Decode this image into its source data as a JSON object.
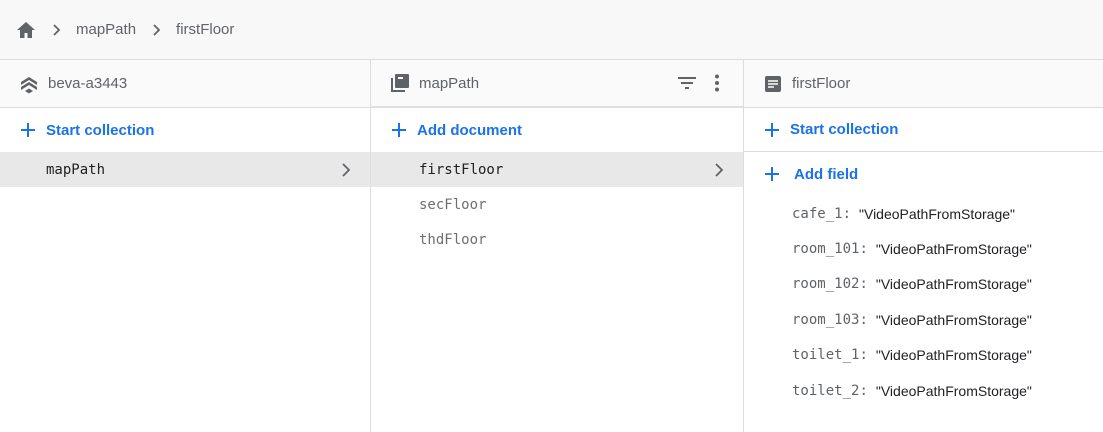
{
  "breadcrumb": {
    "home_icon": "home-icon",
    "items": [
      "mapPath",
      "firstFloor"
    ]
  },
  "panels": {
    "project": {
      "icon": "firestore-icon",
      "title": "beva-a3443",
      "action_label": "Start collection",
      "items": [
        {
          "label": "mapPath",
          "selected": true
        }
      ]
    },
    "collection": {
      "icon": "collection-icon",
      "title": "mapPath",
      "action_label": "Add document",
      "items": [
        {
          "label": "firstFloor",
          "selected": true
        },
        {
          "label": "secFloor",
          "selected": false
        },
        {
          "label": "thdFloor",
          "selected": false
        }
      ]
    },
    "document": {
      "icon": "document-icon",
      "title": "firstFloor",
      "start_collection_label": "Start collection",
      "add_field_label": "Add field",
      "fields": [
        {
          "key": "cafe_1",
          "value": "\"VideoPathFromStorage\""
        },
        {
          "key": "room_101",
          "value": "\"VideoPathFromStorage\""
        },
        {
          "key": "room_102",
          "value": "\"VideoPathFromStorage\""
        },
        {
          "key": "room_103",
          "value": "\"VideoPathFromStorage\""
        },
        {
          "key": "toilet_1",
          "value": "\"VideoPathFromStorage\""
        },
        {
          "key": "toilet_2",
          "value": "\"VideoPathFromStorage\""
        }
      ]
    }
  },
  "colors": {
    "accent": "#1a73e8",
    "selected_bg": "#e8e8e8",
    "text": "#202124",
    "muted": "#5f6368"
  }
}
